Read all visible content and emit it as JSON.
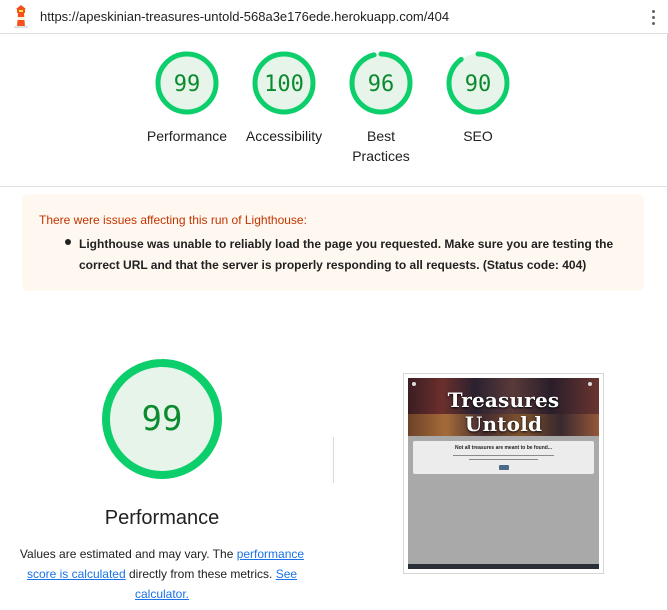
{
  "header": {
    "url": "https://apeskinian-treasures-untold-568a3e176ede.herokuapp.com/404",
    "logo_icon": "lighthouse-icon",
    "menu_icon": "kebab-menu-icon"
  },
  "scores": [
    {
      "value": "99",
      "label": "Performance",
      "score": 0.99
    },
    {
      "value": "100",
      "label": "Accessibility",
      "score": 1.0
    },
    {
      "value": "96",
      "label": "Best Practices",
      "label_line1": "Best",
      "label_line2": "Practices",
      "score": 0.96
    },
    {
      "value": "90",
      "label": "SEO",
      "score": 0.9
    }
  ],
  "colors": {
    "pass": "#0c8a2e",
    "pass_fill": "#e6f4ea",
    "warning_text": "#c33300",
    "warning_bg": "#fff8f0",
    "link": "#1a73e8"
  },
  "warning": {
    "title": "There were issues affecting this run of Lighthouse:",
    "items": [
      "Lighthouse was unable to reliably load the page you requested. Make sure you are testing the correct URL and that the server is properly responding to all requests. (Status code: 404)"
    ]
  },
  "performance": {
    "score": "99",
    "score_fraction": 0.99,
    "title": "Performance",
    "desc_prefix": "Values are estimated and may vary. The ",
    "link1": "performance score is calculated",
    "desc_middle": " directly from these metrics. ",
    "link2": "See calculator."
  },
  "screenshot": {
    "title": "Treasures Untold",
    "card_heading": "Not all treasures are meant to be found..."
  }
}
